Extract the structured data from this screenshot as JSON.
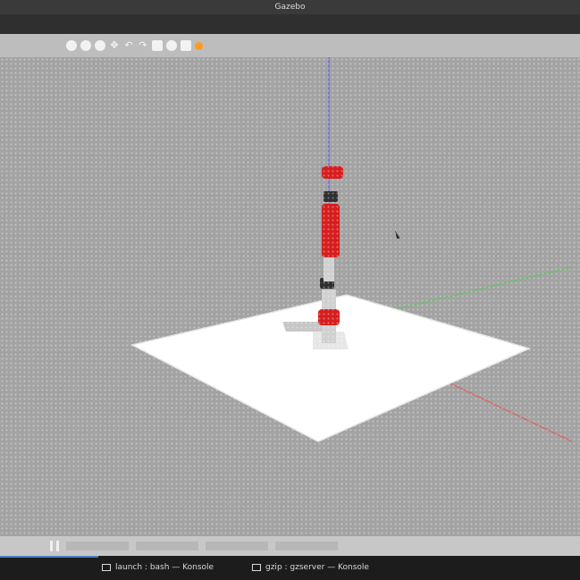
{
  "window": {
    "title": "Gazebo"
  },
  "toolbar": {
    "tools": [
      {
        "name": "select-tool-icon"
      },
      {
        "name": "translate-tool-icon"
      },
      {
        "name": "rotate-tool-icon"
      },
      {
        "name": "scale-tool-icon"
      },
      {
        "name": "undo-icon"
      },
      {
        "name": "redo-icon"
      },
      {
        "name": "box-shape-icon"
      },
      {
        "name": "sphere-shape-icon"
      },
      {
        "name": "cylinder-shape-icon"
      },
      {
        "name": "point-light-icon"
      },
      {
        "name": "spot-light-icon"
      },
      {
        "name": "directional-light-icon"
      }
    ]
  },
  "taskbar": {
    "task1": "launch : bash — Konsole",
    "task2": "gzip : gzserver — Konsole"
  },
  "colors": {
    "viewport_bg": "#a3a3a3",
    "ground": "#ffffff",
    "robot_red": "#d61e1e",
    "robot_gray": "#cfcfcf",
    "axis_x": "#d46a6a",
    "axis_y": "#74b874",
    "axis_z": "#6a6ad4",
    "light_icon": "#ff9a1e"
  }
}
